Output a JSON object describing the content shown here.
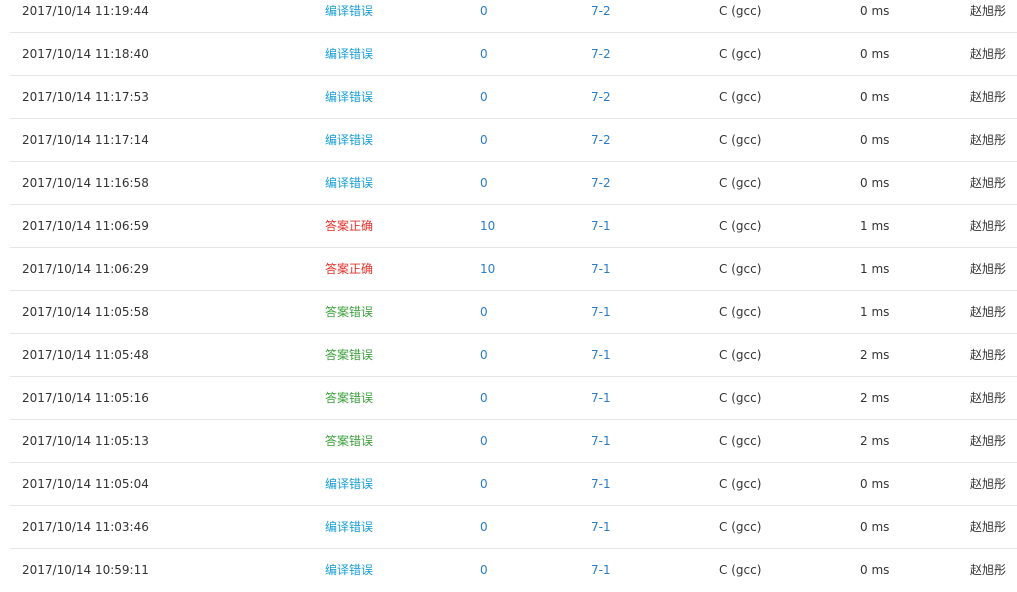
{
  "colors": {
    "compile_error": "#1a9fd6",
    "accepted": "#e0322b",
    "wrong_answer": "#3d9f3d",
    "link": "#2a7cc7"
  },
  "submissions": [
    {
      "time": "2017/10/14 11:19:44",
      "status": "编译错误",
      "status_kind": "compile",
      "score": "0",
      "problem": "7-2",
      "language": "C (gcc)",
      "time_used": "0 ms",
      "user": "赵旭彤"
    },
    {
      "time": "2017/10/14 11:18:40",
      "status": "编译错误",
      "status_kind": "compile",
      "score": "0",
      "problem": "7-2",
      "language": "C (gcc)",
      "time_used": "0 ms",
      "user": "赵旭彤"
    },
    {
      "time": "2017/10/14 11:17:53",
      "status": "编译错误",
      "status_kind": "compile",
      "score": "0",
      "problem": "7-2",
      "language": "C (gcc)",
      "time_used": "0 ms",
      "user": "赵旭彤"
    },
    {
      "time": "2017/10/14 11:17:14",
      "status": "编译错误",
      "status_kind": "compile",
      "score": "0",
      "problem": "7-2",
      "language": "C (gcc)",
      "time_used": "0 ms",
      "user": "赵旭彤"
    },
    {
      "time": "2017/10/14 11:16:58",
      "status": "编译错误",
      "status_kind": "compile",
      "score": "0",
      "problem": "7-2",
      "language": "C (gcc)",
      "time_used": "0 ms",
      "user": "赵旭彤"
    },
    {
      "time": "2017/10/14 11:06:59",
      "status": "答案正确",
      "status_kind": "correct",
      "score": "10",
      "problem": "7-1",
      "language": "C (gcc)",
      "time_used": "1 ms",
      "user": "赵旭彤"
    },
    {
      "time": "2017/10/14 11:06:29",
      "status": "答案正确",
      "status_kind": "correct",
      "score": "10",
      "problem": "7-1",
      "language": "C (gcc)",
      "time_used": "1 ms",
      "user": "赵旭彤"
    },
    {
      "time": "2017/10/14 11:05:58",
      "status": "答案错误",
      "status_kind": "wrong",
      "score": "0",
      "problem": "7-1",
      "language": "C (gcc)",
      "time_used": "1 ms",
      "user": "赵旭彤"
    },
    {
      "time": "2017/10/14 11:05:48",
      "status": "答案错误",
      "status_kind": "wrong",
      "score": "0",
      "problem": "7-1",
      "language": "C (gcc)",
      "time_used": "2 ms",
      "user": "赵旭彤"
    },
    {
      "time": "2017/10/14 11:05:16",
      "status": "答案错误",
      "status_kind": "wrong",
      "score": "0",
      "problem": "7-1",
      "language": "C (gcc)",
      "time_used": "2 ms",
      "user": "赵旭彤"
    },
    {
      "time": "2017/10/14 11:05:13",
      "status": "答案错误",
      "status_kind": "wrong",
      "score": "0",
      "problem": "7-1",
      "language": "C (gcc)",
      "time_used": "2 ms",
      "user": "赵旭彤"
    },
    {
      "time": "2017/10/14 11:05:04",
      "status": "编译错误",
      "status_kind": "compile",
      "score": "0",
      "problem": "7-1",
      "language": "C (gcc)",
      "time_used": "0 ms",
      "user": "赵旭彤"
    },
    {
      "time": "2017/10/14 11:03:46",
      "status": "编译错误",
      "status_kind": "compile",
      "score": "0",
      "problem": "7-1",
      "language": "C (gcc)",
      "time_used": "0 ms",
      "user": "赵旭彤"
    },
    {
      "time": "2017/10/14 10:59:11",
      "status": "编译错误",
      "status_kind": "compile",
      "score": "0",
      "problem": "7-1",
      "language": "C (gcc)",
      "time_used": "0 ms",
      "user": "赵旭彤"
    }
  ]
}
